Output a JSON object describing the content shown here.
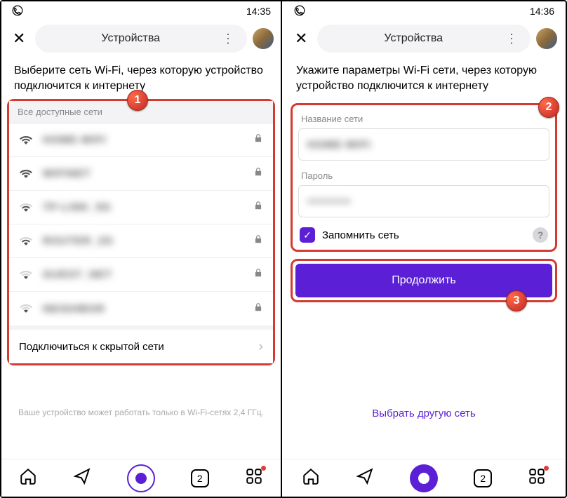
{
  "left": {
    "status_time": "14:35",
    "title": "Устройства",
    "heading": "Выберите сеть Wi-Fi, через которую устройство подключится к интернету",
    "list_header": "Все доступные сети",
    "networks": [
      {
        "name": "HOME-WIFI",
        "strength": "full",
        "locked": true
      },
      {
        "name": "WIFINET",
        "strength": "full",
        "locked": true
      },
      {
        "name": "TP-LINK_5G",
        "strength": "mid",
        "locked": true
      },
      {
        "name": "ROUTER_2G",
        "strength": "mid",
        "locked": true
      },
      {
        "name": "GUEST_NET",
        "strength": "low",
        "locked": true
      },
      {
        "name": "NEIGHBOR",
        "strength": "low",
        "locked": true
      }
    ],
    "hidden_label": "Подключиться к скрытой сети",
    "footnote": "Ваше устройство может работать только в Wi-Fi-сетях 2,4 ГГц.",
    "nav_count": "2"
  },
  "right": {
    "status_time": "14:36",
    "title": "Устройства",
    "heading": "Укажите параметры Wi-Fi сети, через которую устройство подключится к интернету",
    "field_network_label": "Название сети",
    "field_network_value": "HOME-WIFI",
    "field_password_label": "Пароль",
    "field_password_value": "••••••••••",
    "remember_label": "Запомнить сеть",
    "remember_checked": true,
    "continue_label": "Продолжить",
    "other_link": "Выбрать другую сеть",
    "nav_count": "2"
  },
  "badges": {
    "b1": "1",
    "b2": "2",
    "b3": "3"
  }
}
